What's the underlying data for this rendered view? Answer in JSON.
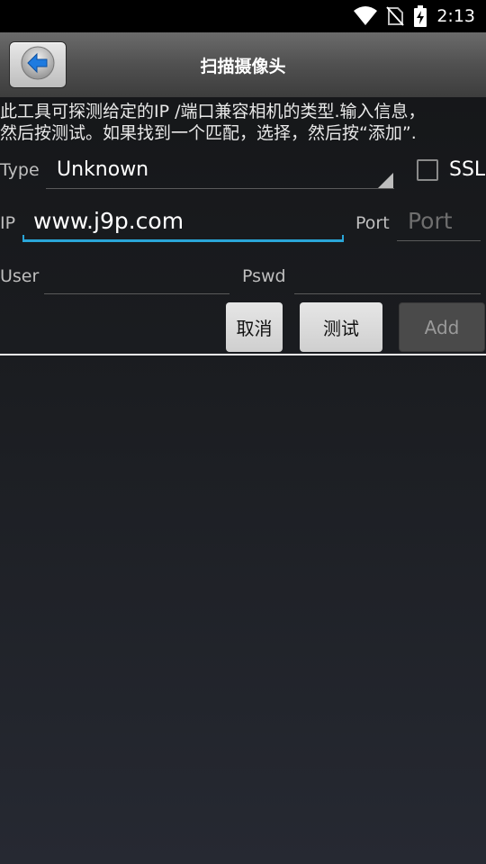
{
  "status_bar": {
    "time": "2:13",
    "icons": [
      "wifi-icon",
      "no-sim-icon",
      "battery-charging-icon"
    ]
  },
  "title_bar": {
    "title": "扫描摄像头",
    "back_icon": "back-arrow-icon",
    "accent": "#1e7be0"
  },
  "description": "此工具可探测给定的IP /端口兼容相机的类型.输入信息，\n然后按测试。如果找到一个匹配，选择，然后按“添加”.",
  "form": {
    "type_label": "Type",
    "type_value": "Unknown",
    "ssl_label": "SSL",
    "ssl_checked": false,
    "ip_label": "IP",
    "ip_value": "www.j9p.com",
    "port_label": "Port",
    "port_placeholder": "Port",
    "user_label": "User",
    "user_value": "",
    "pswd_label": "Pswd",
    "pswd_value": ""
  },
  "buttons": {
    "cancel": "取消",
    "test": "测试",
    "add": "Add"
  },
  "colors": {
    "input_focus": "#2aa6d8",
    "divider": "#f0f0f0"
  }
}
